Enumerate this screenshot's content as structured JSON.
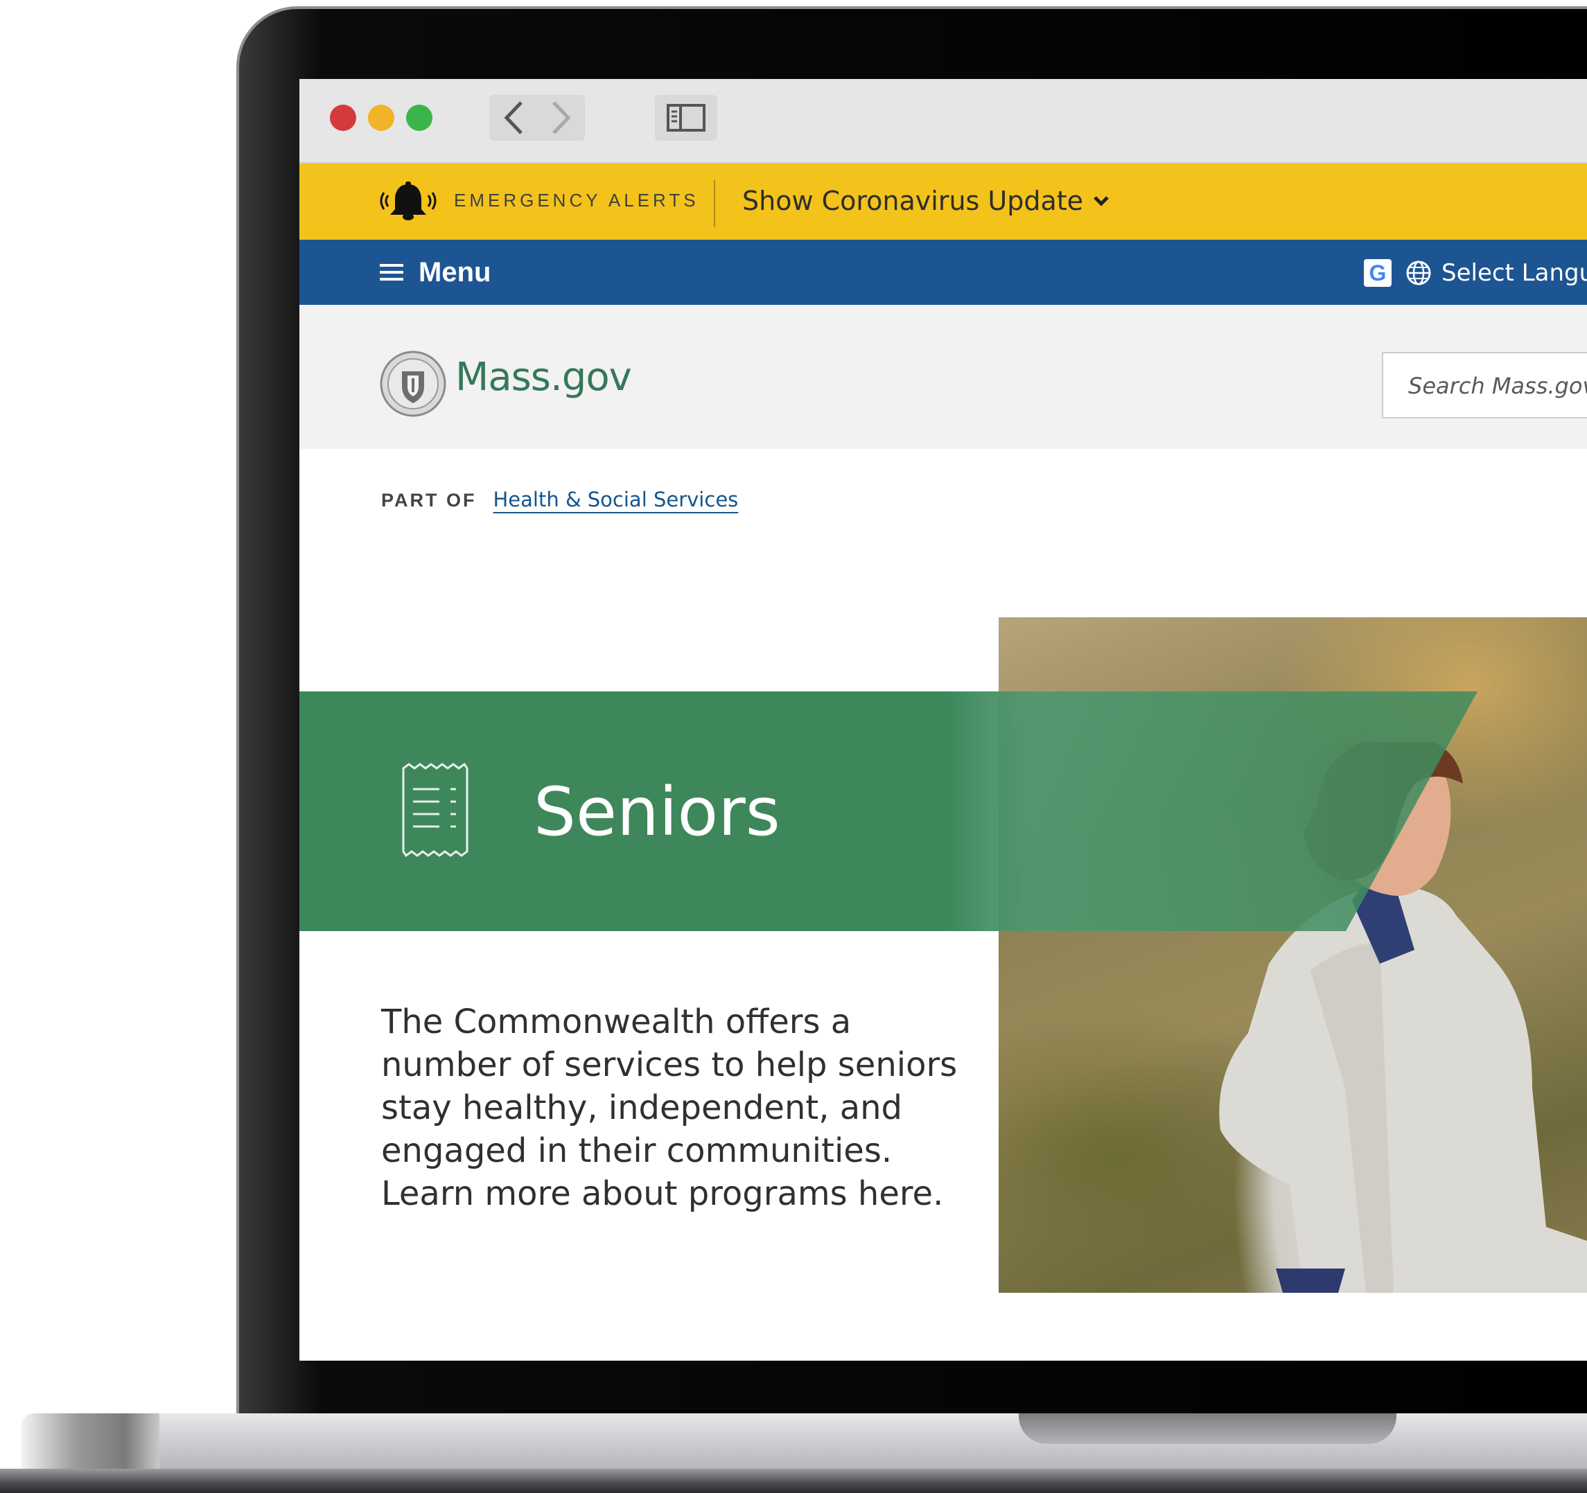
{
  "alert_bar": {
    "label": "EMERGENCY ALERTS",
    "toggle_label": "Show Coronavirus Update"
  },
  "menu_bar": {
    "menu_label": "Menu",
    "language_label": "Select Langu",
    "google_badge": "G"
  },
  "header": {
    "brand": "Mass.gov",
    "search_placeholder": "Search Mass.gov"
  },
  "breadcrumb": {
    "prefix": "PART OF",
    "link": "Health & Social Services"
  },
  "hero": {
    "title": "Seniors",
    "description": "The Commonwealth offers a number of services to help seniors stay healthy, independent, and engaged in their communities. Learn more about programs here."
  },
  "icons": [
    "back-arrow-icon",
    "forward-arrow-icon",
    "sidebar-icon",
    "bell-icon",
    "chevron-down-icon",
    "hamburger-icon",
    "google-icon",
    "globe-icon",
    "state-seal-icon",
    "document-icon"
  ],
  "colors": {
    "alert_yellow": "#f3c21b",
    "menu_blue": "#1d5592",
    "brand_green": "#35795a",
    "banner_green": "#3f8a5c",
    "link_blue": "#14558f"
  }
}
